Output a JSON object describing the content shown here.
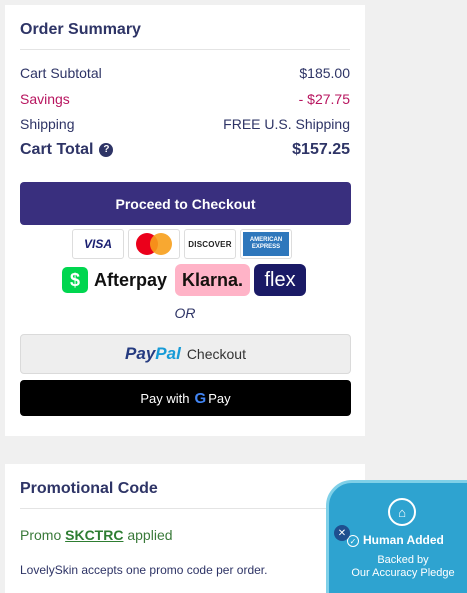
{
  "order_summary": {
    "title": "Order Summary",
    "subtotal_label": "Cart Subtotal",
    "subtotal_value": "$185.00",
    "savings_label": "Savings",
    "savings_value": "- $27.75",
    "shipping_label": "Shipping",
    "shipping_value": "FREE U.S. Shipping",
    "total_label": "Cart Total",
    "total_value": "$157.25",
    "help_icon": "question-circle-icon",
    "checkout_label": "Proceed to Checkout",
    "cards": {
      "visa": "VISA",
      "mastercard": "mastercard-icon",
      "discover": "DISCOVER",
      "amex_line1": "AMERICAN",
      "amex_line2": "EXPRESS"
    },
    "afterpay_label": "Afterpay",
    "afterpay_icon": "$",
    "klarna_label": "Klarna.",
    "flex_label": "flex",
    "or_label": "OR",
    "paypal": {
      "pay": "Pay",
      "pal": "Pal",
      "label": "Checkout"
    },
    "gpay": {
      "prefix": "Pay with",
      "g": "G",
      "pay": "Pay"
    }
  },
  "promo": {
    "title": "Promotional Code",
    "promo_prefix": "Promo",
    "promo_code": "SKCTRC",
    "promo_suffix": "applied",
    "note": "LovelySkin accepts one promo code per order."
  },
  "badge": {
    "icon": "house-shield-icon",
    "title": "Human Added",
    "line1": "Backed by",
    "line2": "Our Accuracy Pledge"
  },
  "colors": {
    "primary": "#392f7e",
    "text": "#2e3466",
    "savings": "#b8155f",
    "promo_green": "#2e7d32",
    "badge_blue": "#2ea3d0"
  }
}
